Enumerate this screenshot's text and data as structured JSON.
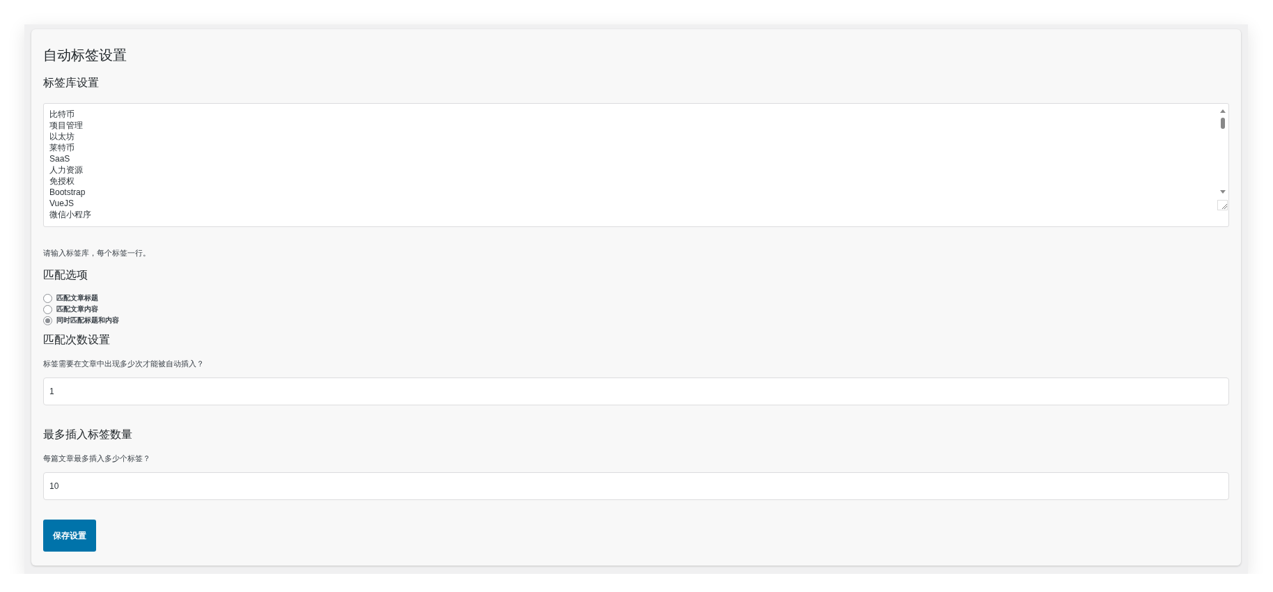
{
  "title": "自动标签设置",
  "tag_library": {
    "heading": "标签库设置",
    "tags": [
      "比特币",
      "项目管理",
      "以太坊",
      "莱特币",
      "SaaS",
      "人力资源",
      "免授权",
      "Bootstrap",
      "VueJS",
      "微信小程序"
    ],
    "help": "请输入标签库，每个标签一行。"
  },
  "match_options": {
    "heading": "匹配选项",
    "options": [
      {
        "label": "匹配文章标题",
        "selected": false
      },
      {
        "label": "匹配文章内容",
        "selected": false
      },
      {
        "label": "同时匹配标题和内容",
        "selected": true
      }
    ]
  },
  "match_count": {
    "heading": "匹配次数设置",
    "description": "标签需要在文章中出现多少次才能被自动插入？",
    "value": "1"
  },
  "max_tags": {
    "heading": "最多插入标签数量",
    "description": "每篇文章最多插入多少个标签？",
    "value": "10"
  },
  "save_button": "保存设置"
}
